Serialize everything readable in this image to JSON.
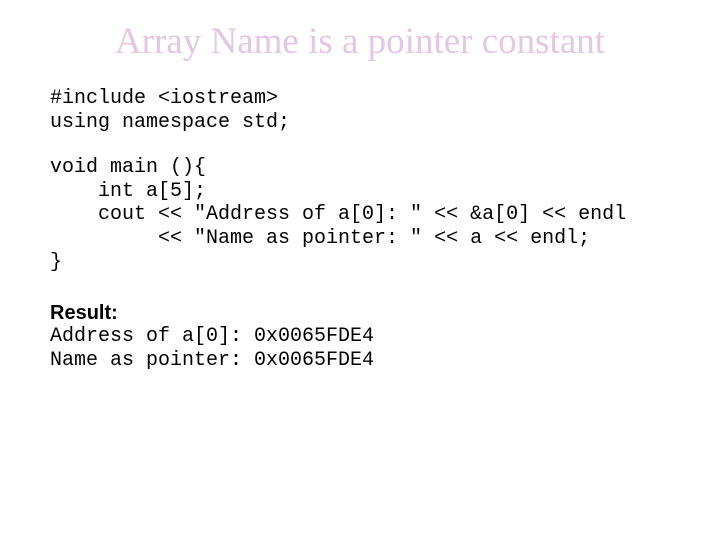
{
  "title": "Array Name is a pointer constant",
  "code": {
    "l1": "#include <iostream>",
    "l2": "using namespace std;",
    "l3": "void main (){",
    "l4": "    int a[5];",
    "l5": "    cout << \"Address of a[0]: \" << &a[0] << endl",
    "l6": "         << \"Name as pointer: \" << a << endl;",
    "l7": "}"
  },
  "result": {
    "label": "Result:",
    "r1": "Address of a[0]: 0x0065FDE4",
    "r2": "Name as pointer: 0x0065FDE4"
  }
}
